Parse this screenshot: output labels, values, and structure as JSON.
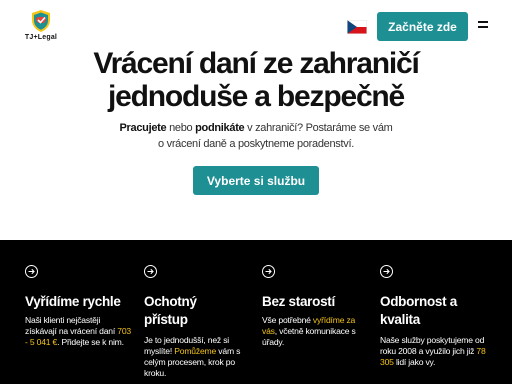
{
  "header": {
    "logo_text": "TJ+Legal",
    "language": "Czech",
    "cta_label": "Začněte zde",
    "menu_icon": "hamburger-menu-icon",
    "flag_colors": [
      "#ffffff",
      "#d7141a",
      "#11457e"
    ]
  },
  "hero": {
    "title_line1": "Vrácení daní ze zahraničí",
    "title_line2": "jednoduše a bezpečně",
    "sub_pre": "Pracujete",
    "sub_mid1": " nebo ",
    "sub_bold2": "podnikáte",
    "sub_rest1": " v zahraničí? Postaráme se vám",
    "sub_line2": "o vrácení daně a poskytneme poradenství.",
    "cta_label": "Vyberte si službu"
  },
  "features": [
    {
      "icon": "arrow-right-circle-icon",
      "title": "Vyřídíme rychle",
      "text_pre": "Naši klienti nejčastěji získávají na vrácení daní ",
      "text_highlight": "703 - 5 041 €",
      "text_post": ". Přidejte se k nim."
    },
    {
      "icon": "arrow-right-circle-icon",
      "title_line1": "Ochotný",
      "title_line2": "přístup",
      "text_pre": "Je to jednodušší, než si myslíte! ",
      "text_highlight": "Pomůžeme",
      "text_post": " vám s celým procesem, krok po kroku."
    },
    {
      "icon": "arrow-right-circle-icon",
      "title": "Bez starostí",
      "text_pre": "Vše potřebné ",
      "text_highlight": "vyřídíme za vás",
      "text_post": ", včetně komunikace s úřady."
    },
    {
      "icon": "arrow-right-circle-icon",
      "title_line1": "Odbornost a",
      "title_line2": "kvalita",
      "text_pre": "Naše služby poskytujeme od roku 2008 a využilo jich již ",
      "text_highlight": "78 305",
      "text_post": " lidí jako vy."
    }
  ],
  "colors": {
    "accent": "#1e8f93",
    "highlight": "#f2c21a",
    "features_bg": "#000000"
  }
}
